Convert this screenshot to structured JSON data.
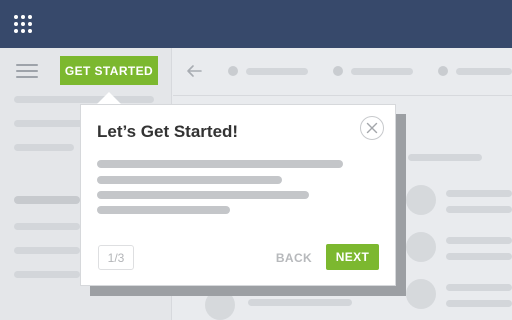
{
  "header": {
    "apps_icon": "apps-grid-icon"
  },
  "sidebar": {
    "menu_icon": "hamburger-icon",
    "get_started_label": "GET STARTED"
  },
  "toolbar": {
    "back_icon": "arrow-left-icon"
  },
  "popover": {
    "title": "Let’s Get Started!",
    "close_icon": "close-icon",
    "step": "1/3",
    "back_label": "BACK",
    "next_label": "NEXT"
  },
  "colors": {
    "header": "#37496b",
    "accent": "#7cb82f",
    "background": "#e9ebee"
  }
}
